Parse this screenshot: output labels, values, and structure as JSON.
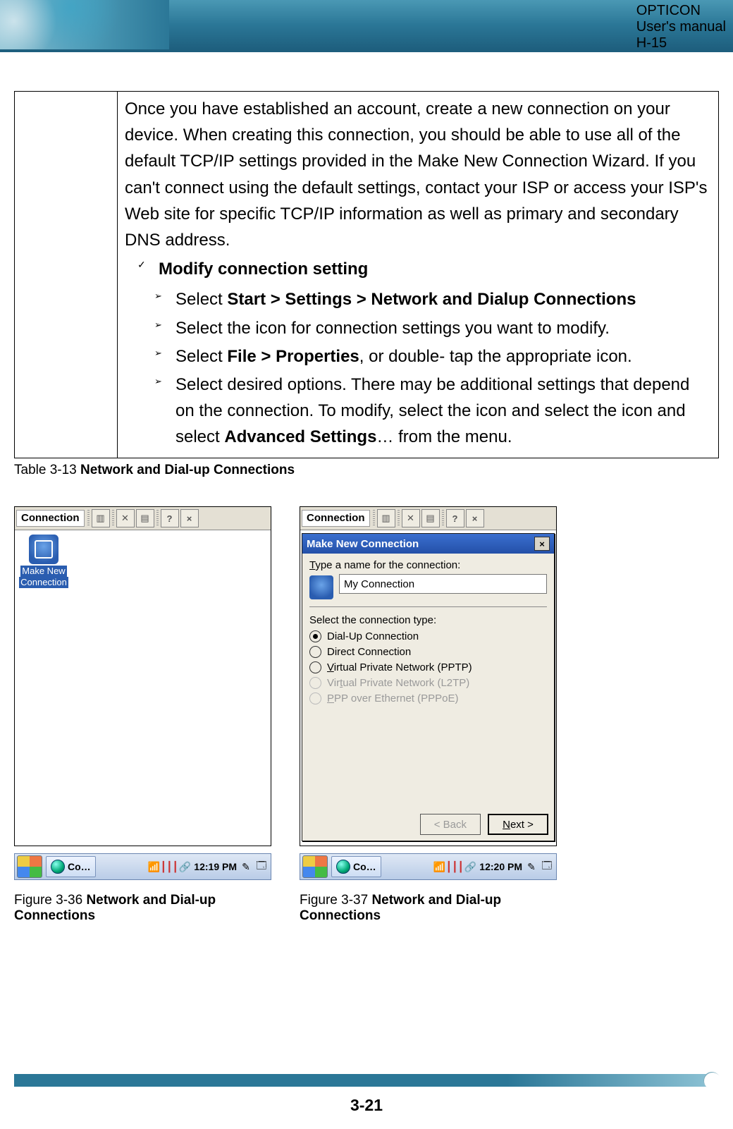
{
  "header": {
    "line1": "OPTICON",
    "line2": "User's manual",
    "line3": "H-15"
  },
  "table": {
    "intro": "Once you have established an account, create a new connection on your device. When creating this connection, you should be able to use all of the default TCP/IP settings provided in the Make New Connection Wizard. If you can't connect using the default settings, contact your ISP or access your ISP's Web site for specific TCP/IP information as well as primary and secondary DNS address.",
    "check": "Modify connection setting",
    "b1_pre": "Select ",
    "b1_bold": "Start > Settings > Network and Dialup Connections",
    "b2": "Select the icon for connection settings you want to modify.",
    "b3_pre": "Select ",
    "b3_bold": "File > Properties",
    "b3_post": ", or double- tap the appropriate icon.",
    "b4_pre": "Select desired options. There may be additional settings that depend on the connection. To modify, select the icon and select the icon and select ",
    "b4_bold": "Advanced Settings",
    "b4_post": "… from the menu."
  },
  "table_caption_pre": "Table 3-13 ",
  "table_caption_bold": "Network and Dial-up Connections",
  "fig1": {
    "toolbar_title": "Connection",
    "icon_label_l1": "Make New",
    "icon_label_l2": "Connection",
    "task_label": "Co…",
    "time": "12:19 PM",
    "caption_pre": "Figure 3-36 ",
    "caption_bold": "Network and Dial-up Connections"
  },
  "fig2": {
    "toolbar_title": "Connection",
    "dlg_title": "Make New Connection",
    "name_label_pre": "T",
    "name_label_post": "ype a name for the connection:",
    "name_value": "My Connection",
    "select_label": "Select the connection type:",
    "r1": "Dial-Up Connection",
    "r2": "Direct Connection",
    "r3_pre": "V",
    "r3_post": "irtual Private Network (PPTP)",
    "r4_pre": "Vir",
    "r4_u": "t",
    "r4_post": "ual Private Network (L2TP)",
    "r5_pre": "P",
    "r5_post": "PP over Ethernet (PPPoE)",
    "back": "< Back",
    "next": "Next >",
    "task_label": "Co…",
    "time": "12:20 PM",
    "caption_pre": "Figure 3-37 ",
    "caption_bold": "Network and Dial-up Connections"
  },
  "page_number": "3-21"
}
